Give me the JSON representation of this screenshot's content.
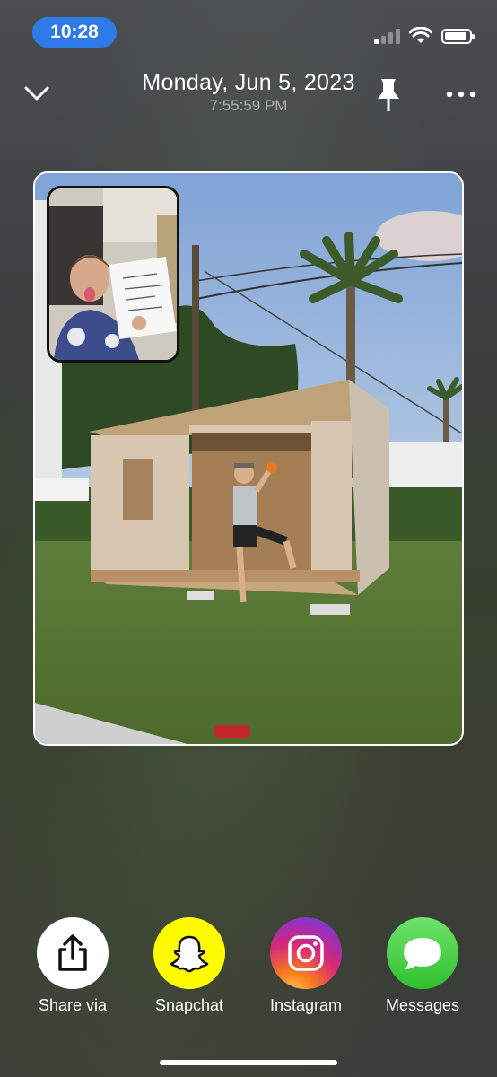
{
  "status_bar": {
    "time": "10:28"
  },
  "header": {
    "date": "Monday, Jun 5, 2023",
    "time": "7:55:59 PM"
  },
  "photo": {
    "description_icon": "photo-with-front-camera-inset"
  },
  "share_options": [
    {
      "label": "Share via",
      "icon": "share-icon",
      "color": "#ffffff"
    },
    {
      "label": "Snapchat",
      "icon": "snapchat-ghost-icon",
      "color": "#fffc00"
    },
    {
      "label": "Instagram",
      "icon": "instagram-icon",
      "color": "#e1306c"
    },
    {
      "label": "Messages",
      "icon": "messages-bubble-icon",
      "color": "#35c759"
    }
  ]
}
